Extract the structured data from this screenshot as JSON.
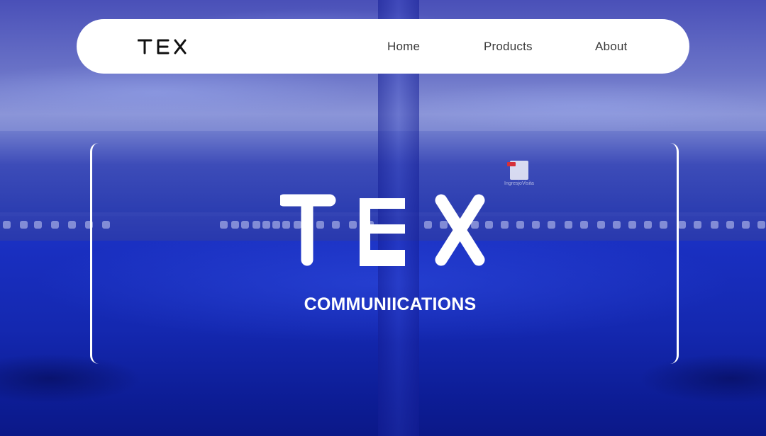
{
  "nav": {
    "logo_text": "TEX",
    "links": [
      {
        "label": "Home"
      },
      {
        "label": "Products"
      },
      {
        "label": "About"
      }
    ]
  },
  "hero": {
    "logo_text": "TEX",
    "subtitle": "COMMUNIICATIONS"
  },
  "desktop": {
    "file_label": "IngresjoVisita"
  },
  "colors": {
    "nav_bg": "#ffffff",
    "nav_text": "#3a3a3a",
    "hero_text": "#ffffff",
    "background_tint": "#1428b0"
  }
}
